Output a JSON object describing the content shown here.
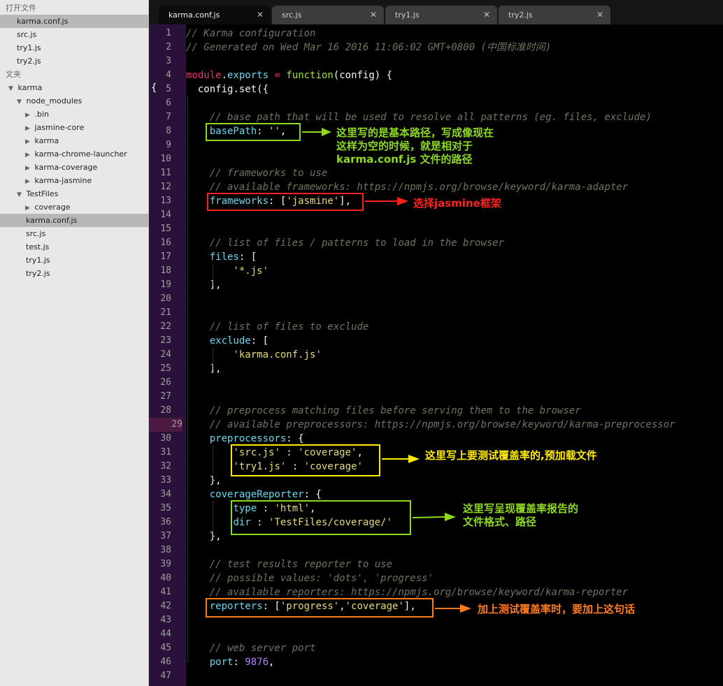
{
  "sidebar": {
    "open_files_header": "打开文件",
    "open_files": [
      "karma.conf.js",
      "src.js",
      "try1.js",
      "try2.js"
    ],
    "folders_header": "文夹",
    "tree": [
      {
        "label": "karma",
        "arrow": "▼"
      },
      {
        "label": "node_modules",
        "arrow": "▼"
      },
      {
        "label": ".bin",
        "arrow": "▶"
      },
      {
        "label": "jasmine-core",
        "arrow": "▶"
      },
      {
        "label": "karma",
        "arrow": "▶"
      },
      {
        "label": "karma-chrome-launcher",
        "arrow": "▶"
      },
      {
        "label": "karma-coverage",
        "arrow": "▶"
      },
      {
        "label": "karma-jasmine",
        "arrow": "▶"
      },
      {
        "label": "TestFiles",
        "arrow": "▼"
      },
      {
        "label": "coverage",
        "arrow": "▶"
      },
      {
        "label": "karma.conf.js",
        "arrow": ""
      },
      {
        "label": "src.js",
        "arrow": ""
      },
      {
        "label": "test.js",
        "arrow": ""
      },
      {
        "label": "try1.js",
        "arrow": ""
      },
      {
        "label": "try2.js",
        "arrow": ""
      }
    ]
  },
  "tabs": [
    {
      "label": "karma.conf.js",
      "close": "✕"
    },
    {
      "label": "src.js",
      "close": "✕"
    },
    {
      "label": "try1.js",
      "close": "✕"
    },
    {
      "label": "try2.js",
      "close": "✕"
    }
  ],
  "editor": {
    "fold_marker": "{",
    "line_numbers": [
      "1",
      "2",
      "3",
      "4",
      "5",
      "6",
      "7",
      "8",
      "9",
      "10",
      "11",
      "12",
      "13",
      "14",
      "15",
      "16",
      "17",
      "18",
      "19",
      "20",
      "21",
      "22",
      "23",
      "24",
      "25",
      "26",
      "27",
      "28",
      "29",
      "30",
      "31",
      "32",
      "33",
      "34",
      "35",
      "36",
      "37",
      "38",
      "39",
      "40",
      "41",
      "42",
      "43",
      "44",
      "45",
      "46",
      "47"
    ],
    "lines": [
      [
        [
          "c",
          "// Karma configuration"
        ]
      ],
      [
        [
          "c",
          "// Generated on Wed Mar 16 2016 11:06:02 GMT+0800 (中国标准时间)"
        ]
      ],
      [],
      [
        [
          "k",
          "module"
        ],
        [
          "p",
          "."
        ],
        [
          "f",
          "exports"
        ],
        [
          "p",
          " "
        ],
        [
          "k",
          "="
        ],
        [
          "p",
          " "
        ],
        [
          "fn",
          "function"
        ],
        [
          "p",
          "("
        ],
        [
          "p",
          "config"
        ],
        [
          "p",
          ") {"
        ]
      ],
      [
        [
          "p",
          "  "
        ],
        [
          "p",
          "config"
        ],
        [
          "p",
          "."
        ],
        [
          "p",
          "set"
        ],
        [
          "p",
          "({"
        ]
      ],
      [],
      [
        [
          "p",
          "    "
        ],
        [
          "c",
          "// base path that will be used to resolve all patterns (eg. files, exclude)"
        ]
      ],
      [
        [
          "p",
          "    "
        ],
        [
          "f",
          "basePath"
        ],
        [
          "p",
          ": "
        ],
        [
          "s",
          "''"
        ],
        [
          "p",
          ","
        ]
      ],
      [],
      [],
      [
        [
          "p",
          "    "
        ],
        [
          "c",
          "// frameworks to use"
        ]
      ],
      [
        [
          "p",
          "    "
        ],
        [
          "c",
          "// available frameworks: https://npmjs.org/browse/keyword/karma-adapter"
        ]
      ],
      [
        [
          "p",
          "    "
        ],
        [
          "f",
          "frameworks"
        ],
        [
          "p",
          ": ["
        ],
        [
          "s",
          "'jasmine'"
        ],
        [
          "p",
          "],"
        ]
      ],
      [],
      [],
      [
        [
          "p",
          "    "
        ],
        [
          "c",
          "// list of files / patterns to load in the browser"
        ]
      ],
      [
        [
          "p",
          "    "
        ],
        [
          "f",
          "files"
        ],
        [
          "p",
          ": ["
        ]
      ],
      [
        [
          "p",
          "        "
        ],
        [
          "s",
          "'*.js'"
        ]
      ],
      [
        [
          "p",
          "    ],"
        ]
      ],
      [],
      [],
      [
        [
          "p",
          "    "
        ],
        [
          "c",
          "// list of files to exclude"
        ]
      ],
      [
        [
          "p",
          "    "
        ],
        [
          "f",
          "exclude"
        ],
        [
          "p",
          ": ["
        ]
      ],
      [
        [
          "p",
          "        "
        ],
        [
          "s",
          "'karma.conf.js'"
        ]
      ],
      [
        [
          "p",
          "    ],"
        ]
      ],
      [],
      [],
      [
        [
          "p",
          "    "
        ],
        [
          "c",
          "// preprocess matching files before serving them to the browser"
        ]
      ],
      [
        [
          "p",
          "    "
        ],
        [
          "c",
          "// available preprocessors: https://npmjs.org/browse/keyword/karma-preprocessor"
        ]
      ],
      [
        [
          "p",
          "    "
        ],
        [
          "f",
          "preprocessors"
        ],
        [
          "p",
          ": {"
        ]
      ],
      [
        [
          "p",
          "        "
        ],
        [
          "s",
          "'src.js'"
        ],
        [
          "p",
          " : "
        ],
        [
          "s",
          "'coverage'"
        ],
        [
          "p",
          ","
        ]
      ],
      [
        [
          "p",
          "        "
        ],
        [
          "s",
          "'try1.js'"
        ],
        [
          "p",
          " : "
        ],
        [
          "s",
          "'coverage'"
        ]
      ],
      [
        [
          "p",
          "    },"
        ]
      ],
      [
        [
          "p",
          "    "
        ],
        [
          "f",
          "coverageReporter"
        ],
        [
          "p",
          ": {"
        ]
      ],
      [
        [
          "p",
          "        "
        ],
        [
          "f",
          "type"
        ],
        [
          "p",
          " : "
        ],
        [
          "s",
          "'html'"
        ],
        [
          "p",
          ","
        ]
      ],
      [
        [
          "p",
          "        "
        ],
        [
          "f",
          "dir"
        ],
        [
          "p",
          " : "
        ],
        [
          "s",
          "'TestFiles/coverage/'"
        ]
      ],
      [
        [
          "p",
          "    },"
        ]
      ],
      [],
      [
        [
          "p",
          "    "
        ],
        [
          "c",
          "// test results reporter to use"
        ]
      ],
      [
        [
          "p",
          "    "
        ],
        [
          "c",
          "// possible values: 'dots', 'progress'"
        ]
      ],
      [
        [
          "p",
          "    "
        ],
        [
          "c",
          "// available reporters: https://npmjs.org/browse/keyword/karma-reporter"
        ]
      ],
      [
        [
          "p",
          "    "
        ],
        [
          "f",
          "reporters"
        ],
        [
          "p",
          ": ["
        ],
        [
          "s",
          "'progress'"
        ],
        [
          "p",
          ","
        ],
        [
          "s",
          "'coverage'"
        ],
        [
          "p",
          "],"
        ]
      ],
      [],
      [],
      [
        [
          "p",
          "    "
        ],
        [
          "c",
          "// web server port"
        ]
      ],
      [
        [
          "p",
          "    "
        ],
        [
          "f",
          "port"
        ],
        [
          "p",
          ": "
        ],
        [
          "n",
          "9876"
        ],
        [
          "p",
          ","
        ]
      ],
      []
    ]
  },
  "annotations": {
    "base_path_note": [
      "这里写的是基本路径，写成像现在",
      "这样为空的时候，就是相对于",
      "karma.conf.js 文件的路径"
    ],
    "frameworks_note": "选择jasmine框架",
    "preprocessors_note": "这里写上要测试覆盖率的,预加载文件",
    "coverage_reporter_note": [
      "这里写呈现覆盖率报告的",
      "文件格式、路径"
    ],
    "reporters_note": "加上测试覆盖率时，要加上这句话",
    "colors": {
      "green": "#8ed81e",
      "red": "#ff2020",
      "yellow": "#ffea00",
      "orange": "#ff7a18"
    }
  }
}
